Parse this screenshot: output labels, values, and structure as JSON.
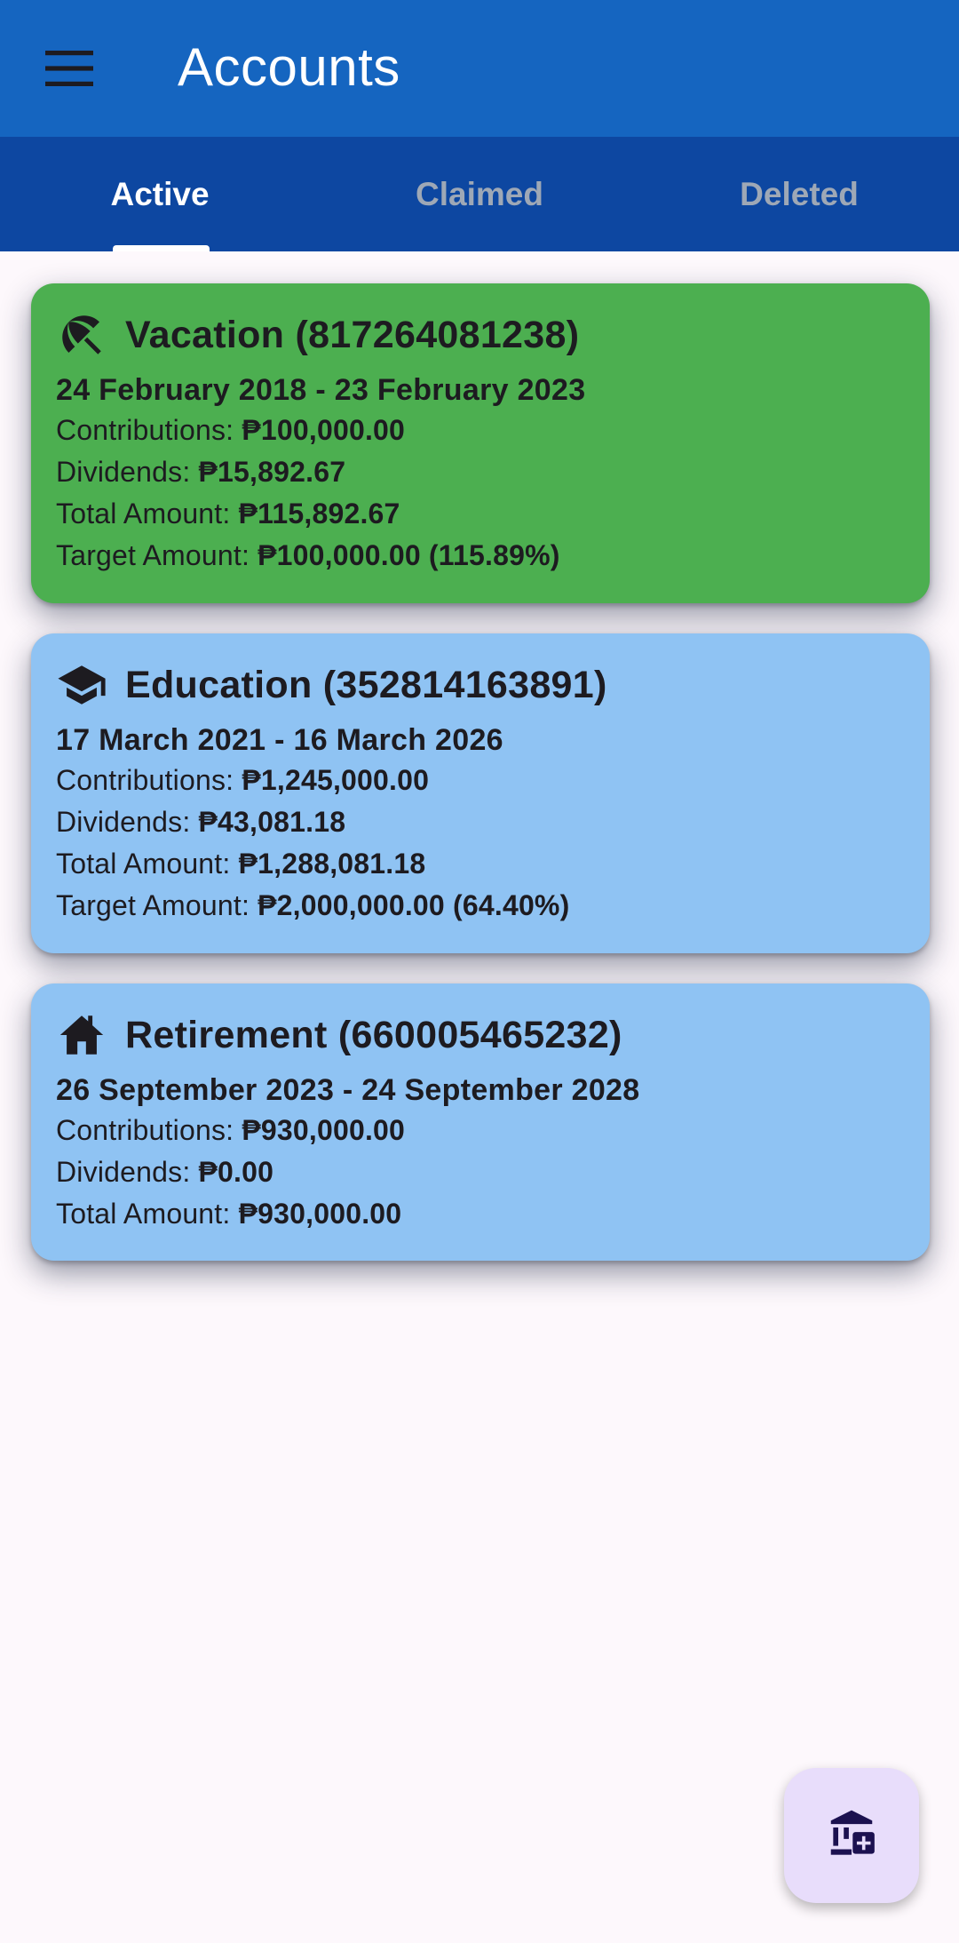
{
  "appbar": {
    "title": "Accounts",
    "menu_icon": "menu-icon"
  },
  "tabs": [
    {
      "label": "Active",
      "selected": true
    },
    {
      "label": "Claimed",
      "selected": false
    },
    {
      "label": "Deleted",
      "selected": false
    }
  ],
  "accounts": [
    {
      "icon": "beach-umbrella-icon",
      "color": "#4caf50",
      "title": "Vacation (817264081238)",
      "dates": "24 February 2018 - 23 February 2023",
      "contributions_label": "Contributions: ",
      "contributions": "₱100,000.00",
      "dividends_label": "Dividends: ",
      "dividends": "₱15,892.67",
      "total_label": "Total Amount: ",
      "total": "₱115,892.67",
      "target_label": "Target Amount: ",
      "target": "₱100,000.00 (115.89%)"
    },
    {
      "icon": "graduation-cap-icon",
      "color": "#8fc3f3",
      "title": "Education (352814163891)",
      "dates": "17 March 2021 - 16 March 2026",
      "contributions_label": "Contributions: ",
      "contributions": "₱1,245,000.00",
      "dividends_label": "Dividends: ",
      "dividends": "₱43,081.18",
      "total_label": "Total Amount: ",
      "total": "₱1,288,081.18",
      "target_label": "Target Amount: ",
      "target": "₱2,000,000.00 (64.40%)"
    },
    {
      "icon": "house-icon",
      "color": "#8fc3f3",
      "title": "Retirement (660005465232)",
      "dates": "26 September 2023 - 24 September 2028",
      "contributions_label": "Contributions: ",
      "contributions": "₱930,000.00",
      "dividends_label": "Dividends: ",
      "dividends": "₱0.00",
      "total_label": "Total Amount: ",
      "total": "₱930,000.00"
    }
  ],
  "fab": {
    "icon": "add-bank-icon"
  }
}
